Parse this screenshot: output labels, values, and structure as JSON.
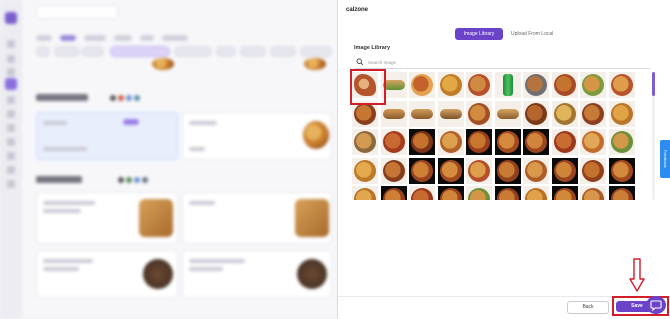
{
  "panel": {
    "title": "calzone",
    "tabs": [
      {
        "label": "Image Library",
        "active": true
      },
      {
        "label": "Upload From Local",
        "active": false
      }
    ],
    "library_label": "Image Library",
    "search": {
      "placeholder": "Search Image",
      "value": ""
    },
    "selected_image_index": 0,
    "images": [
      {
        "name": "calzone-on-plate",
        "style": "light",
        "colors": [
          "#b5552e",
          "#e6b07a"
        ]
      },
      {
        "name": "sub-sandwich",
        "style": "light",
        "colors": [
          "#d7a35f",
          "#5d8f33"
        ]
      },
      {
        "name": "pepperoni-pizza",
        "style": "light",
        "colors": [
          "#c4622b",
          "#e4a14e"
        ]
      },
      {
        "name": "cheese-pizza",
        "style": "light",
        "colors": [
          "#e2a844",
          "#c07c27"
        ]
      },
      {
        "name": "pizza-slice-box",
        "style": "light",
        "colors": [
          "#d08a44",
          "#b7512b"
        ]
      },
      {
        "name": "soda-can",
        "style": "light",
        "colors": [
          "#1d8a3b",
          "#4cc25d"
        ]
      },
      {
        "name": "chicken-bites-bowl",
        "style": "light",
        "colors": [
          "#b5733d",
          "#6f6f74"
        ]
      },
      {
        "name": "supreme-pizza",
        "style": "light",
        "colors": [
          "#c4742f",
          "#a64b26"
        ]
      },
      {
        "name": "veggie-pizza",
        "style": "light",
        "colors": [
          "#d69447",
          "#7a9c3e"
        ]
      },
      {
        "name": "margherita-pizza",
        "style": "light",
        "colors": [
          "#dd9d4b",
          "#b9532b"
        ]
      },
      {
        "name": "bbq-pizza",
        "style": "light",
        "colors": [
          "#c77632",
          "#8a3f1f"
        ]
      },
      {
        "name": "sandwich-rolls",
        "style": "light",
        "colors": [
          "#d29a57",
          "#8b5b2c"
        ]
      },
      {
        "name": "hotdog-tray-1",
        "style": "light",
        "colors": [
          "#cf9e5c",
          "#8c5a2a"
        ]
      },
      {
        "name": "hotdog-tray-2",
        "style": "light",
        "colors": [
          "#d3a462",
          "#7d5129"
        ]
      },
      {
        "name": "pizza-tray",
        "style": "light",
        "colors": [
          "#d28a3e",
          "#a05024"
        ]
      },
      {
        "name": "hotdog-tray-3",
        "style": "light",
        "colors": [
          "#d7a766",
          "#8c5c2b"
        ]
      },
      {
        "name": "wings-tray",
        "style": "light",
        "colors": [
          "#b6652d",
          "#7a3a1a"
        ]
      },
      {
        "name": "fries-tray",
        "style": "light",
        "colors": [
          "#e0b45a",
          "#a37530"
        ]
      },
      {
        "name": "meatball-pizza",
        "style": "light",
        "colors": [
          "#c57a38",
          "#8e3f1f"
        ]
      },
      {
        "name": "cheese-pizza-2",
        "style": "light",
        "colors": [
          "#e0a447",
          "#ba7529"
        ]
      },
      {
        "name": "mushroom-pizza",
        "style": "light",
        "colors": [
          "#d39a52",
          "#8d6a3d"
        ]
      },
      {
        "name": "pepperoni-pizza-2",
        "style": "light",
        "colors": [
          "#c86a30",
          "#a43a1e"
        ]
      },
      {
        "name": "deep-dish-pizza",
        "style": "dark",
        "colors": [
          "#c5712e",
          "#7d3419"
        ]
      },
      {
        "name": "pizza-whole",
        "style": "light",
        "colors": [
          "#dca04f",
          "#b3632a"
        ]
      },
      {
        "name": "pizza-black-1",
        "style": "dark",
        "colors": [
          "#c9772f",
          "#9b3e1c"
        ]
      },
      {
        "name": "pizza-black-2",
        "style": "dark",
        "colors": [
          "#d48b3d",
          "#a44a21"
        ]
      },
      {
        "name": "pizza-black-3",
        "style": "dark",
        "colors": [
          "#d1853a",
          "#9c4520"
        ]
      },
      {
        "name": "pepperoni-pizza-3",
        "style": "light",
        "colors": [
          "#c96c31",
          "#9f371c"
        ]
      },
      {
        "name": "hawaiian-pizza",
        "style": "light",
        "colors": [
          "#dfa757",
          "#c46b2c"
        ]
      },
      {
        "name": "veggie-pizza-2",
        "style": "light",
        "colors": [
          "#d29748",
          "#6c8f39"
        ]
      },
      {
        "name": "cheese-pizza-3",
        "style": "light",
        "colors": [
          "#e3ab4d",
          "#bd7a2b"
        ]
      },
      {
        "name": "bbq-pizza-2",
        "style": "light",
        "colors": [
          "#c67634",
          "#873d1d"
        ]
      },
      {
        "name": "pizza-black-4",
        "style": "dark",
        "colors": [
          "#cf8036",
          "#9a431f"
        ]
      },
      {
        "name": "pizza-black-5",
        "style": "dark",
        "colors": [
          "#d48d3f",
          "#a04a21"
        ]
      },
      {
        "name": "margherita-pizza-2",
        "style": "light",
        "colors": [
          "#dd9f4b",
          "#b64f29"
        ]
      },
      {
        "name": "pizza-black-6",
        "style": "dark",
        "colors": [
          "#c97a34",
          "#93401e"
        ]
      },
      {
        "name": "pizza-whole-2",
        "style": "light",
        "colors": [
          "#d9984a",
          "#ae5d28"
        ]
      },
      {
        "name": "pizza-black-7",
        "style": "dark",
        "colors": [
          "#cf8538",
          "#99441f"
        ]
      },
      {
        "name": "supreme-pizza-2",
        "style": "light",
        "colors": [
          "#c47130",
          "#91401d"
        ]
      },
      {
        "name": "pizza-black-8",
        "style": "dark",
        "colors": [
          "#d38a3c",
          "#a1481f"
        ]
      },
      {
        "name": "cheese-pizza-4",
        "style": "light",
        "colors": [
          "#e2a74c",
          "#b8742a"
        ]
      },
      {
        "name": "pizza-black-9",
        "style": "dark",
        "colors": [
          "#cd7f36",
          "#97421e"
        ]
      },
      {
        "name": "pepperoni-pizza-4",
        "style": "light",
        "colors": [
          "#c76a30",
          "#9d381c"
        ]
      },
      {
        "name": "pizza-black-10",
        "style": "dark",
        "colors": [
          "#d08538",
          "#9b441f"
        ]
      },
      {
        "name": "veggie-pizza-3",
        "style": "light",
        "colors": [
          "#d39548",
          "#6e903a"
        ]
      },
      {
        "name": "pizza-black-11",
        "style": "dark",
        "colors": [
          "#c97b35",
          "#94401e"
        ]
      },
      {
        "name": "cheese-pizza-5",
        "style": "light",
        "colors": [
          "#dfa24a",
          "#b77129"
        ]
      },
      {
        "name": "pizza-black-12",
        "style": "dark",
        "colors": [
          "#d18839",
          "#9e461f"
        ]
      },
      {
        "name": "pizza-whole-3",
        "style": "light",
        "colors": [
          "#d8964a",
          "#ab5b27"
        ]
      },
      {
        "name": "pizza-black-13",
        "style": "dark",
        "colors": [
          "#cc7d36",
          "#96421e"
        ]
      }
    ],
    "back_label": "Back",
    "save_label": "Save",
    "feedback_label": "Feedback"
  },
  "colors": {
    "accent": "#6a43c9",
    "highlight": "#d21d2b"
  }
}
